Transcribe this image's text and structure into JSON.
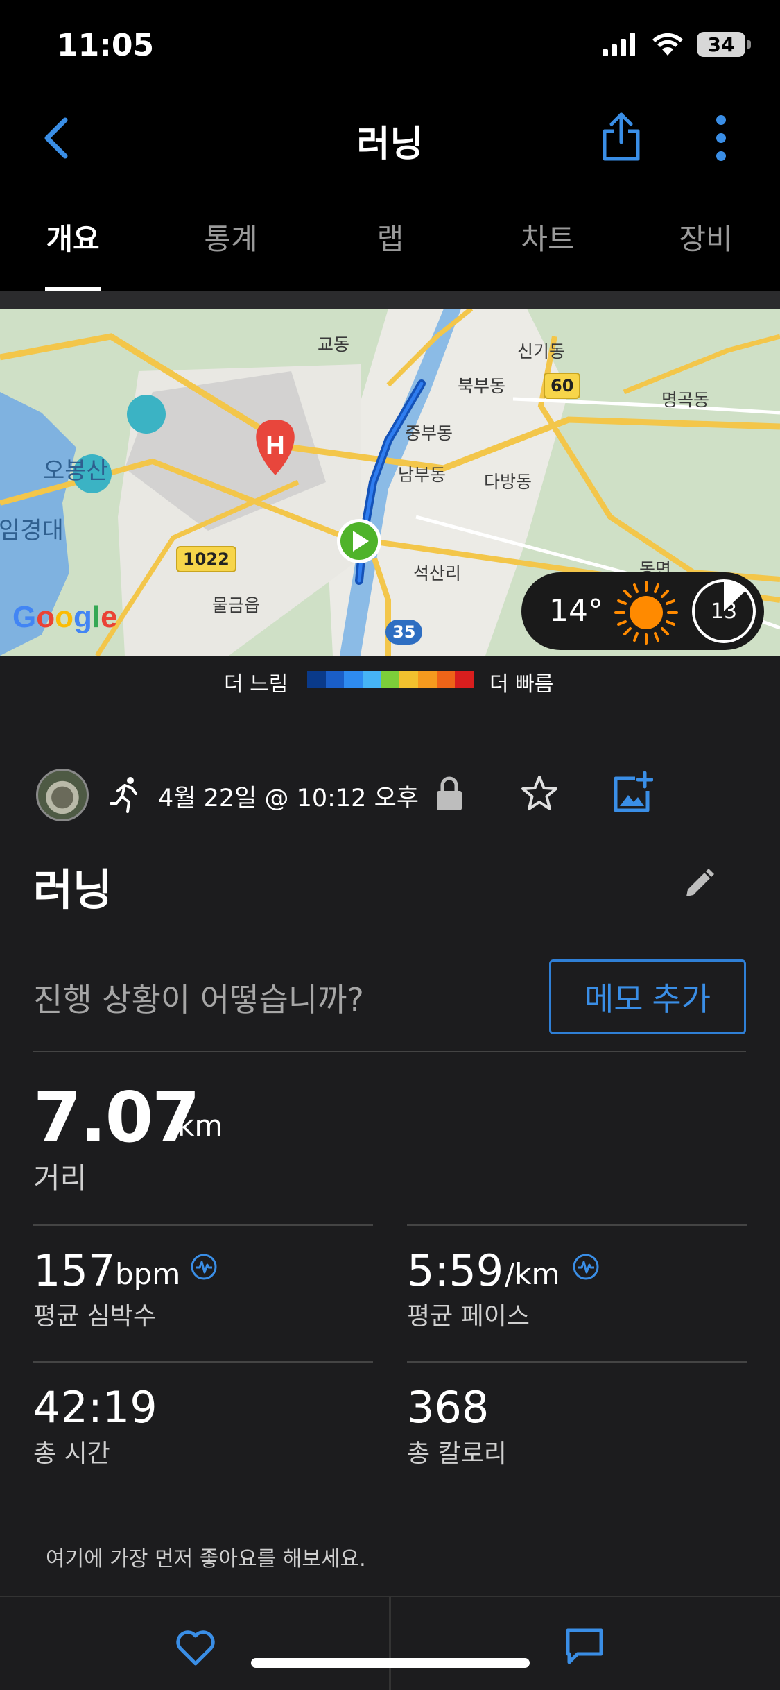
{
  "status_bar": {
    "time": "11:05",
    "battery": "34"
  },
  "nav": {
    "title": "러닝",
    "back_icon": "chevron-left-icon",
    "share_icon": "share-icon",
    "more_icon": "more-vertical-icon"
  },
  "tabs": [
    {
      "label": "개요",
      "active": true
    },
    {
      "label": "통계",
      "active": false
    },
    {
      "label": "랩",
      "active": false
    },
    {
      "label": "차트",
      "active": false
    },
    {
      "label": "장비",
      "active": false
    }
  ],
  "map": {
    "labels": [
      "교동",
      "신기동",
      "북부동",
      "명곡동",
      "중부동",
      "오봉산",
      "남부동",
      "다방동",
      "임경대",
      "석산리",
      "물금읍",
      "동면"
    ],
    "roads": [
      "60",
      "1022",
      "35"
    ],
    "google": "Google"
  },
  "weather": {
    "temp": "14°",
    "wind": "13"
  },
  "legend": {
    "slow": "더 느림",
    "fast": "더 빠름",
    "colors": [
      "#0a3a8a",
      "#1a5ec8",
      "#2e8bf0",
      "#46b4f5",
      "#7ccf3a",
      "#f2c12e",
      "#f59a1e",
      "#ee6418",
      "#d81e1e"
    ]
  },
  "activity": {
    "date": "4월 22일 @ 10:12 오후",
    "title": "러닝",
    "progress_question": "진행 상황이 어떻습니까?",
    "memo_button": "메모 추가"
  },
  "stats": {
    "distance": {
      "value": "7.07",
      "unit": "km",
      "label": "거리"
    },
    "avg_hr": {
      "value": "157",
      "unit": "bpm",
      "label": "평균 심박수"
    },
    "avg_pace": {
      "value": "5:59",
      "unit": "/km",
      "label": "평균 페이스"
    },
    "total_time": {
      "value": "42:19",
      "label": "총 시간"
    },
    "calories": {
      "value": "368",
      "label": "총 칼로리"
    }
  },
  "social": {
    "like_prompt": "여기에 가장 먼저 좋아요를 해보세요."
  }
}
